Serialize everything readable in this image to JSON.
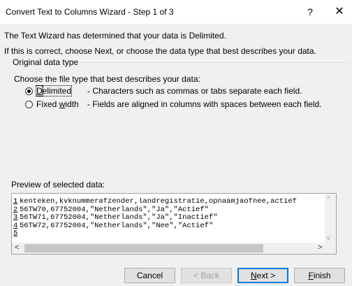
{
  "window": {
    "title": "Convert Text to Columns Wizard - Step 1 of 3",
    "help_label": "?",
    "close_label": "✕"
  },
  "intro": {
    "line1": "The Text Wizard has determined that your data is Delimited.",
    "line2": "If this is correct, choose Next, or choose the data type that best describes your data."
  },
  "original_data_type": {
    "legend": "Original data type",
    "prompt": "Choose the file type that best describes your data:",
    "options": [
      {
        "label_pre": "",
        "label_ul": "D",
        "label_post": "elimited",
        "description": "- Characters such as commas or tabs separate each field.",
        "checked": true
      },
      {
        "label_pre": "Fixed ",
        "label_ul": "w",
        "label_post": "idth",
        "description": "- Fields are aligned in columns with spaces between each field.",
        "checked": false
      }
    ]
  },
  "preview": {
    "label": "Preview of selected data:",
    "rows": [
      {
        "num": "1",
        "text": "kenteken,kvknummerafzender,landregistratie,opnaamjaofnee,actief"
      },
      {
        "num": "2",
        "text": "56TW70,67752004,\"Netherlands\",\"Ja\",\"Actief\""
      },
      {
        "num": "3",
        "text": "56TW71,67752004,\"Netherlands\",\"Ja\",\"Inactief\""
      },
      {
        "num": "4",
        "text": "56TW72,67752004,\"Netherlands\",\"Nee\",\"Actief\""
      },
      {
        "num": "5",
        "text": ""
      }
    ],
    "scroll_left": "<",
    "scroll_right": ">",
    "scroll_up": "^",
    "scroll_down": "v"
  },
  "buttons": {
    "cancel": "Cancel",
    "back": "< Back",
    "next_ul": "N",
    "next_post": "ext >",
    "finish_ul": "F",
    "finish_post": "inish"
  }
}
